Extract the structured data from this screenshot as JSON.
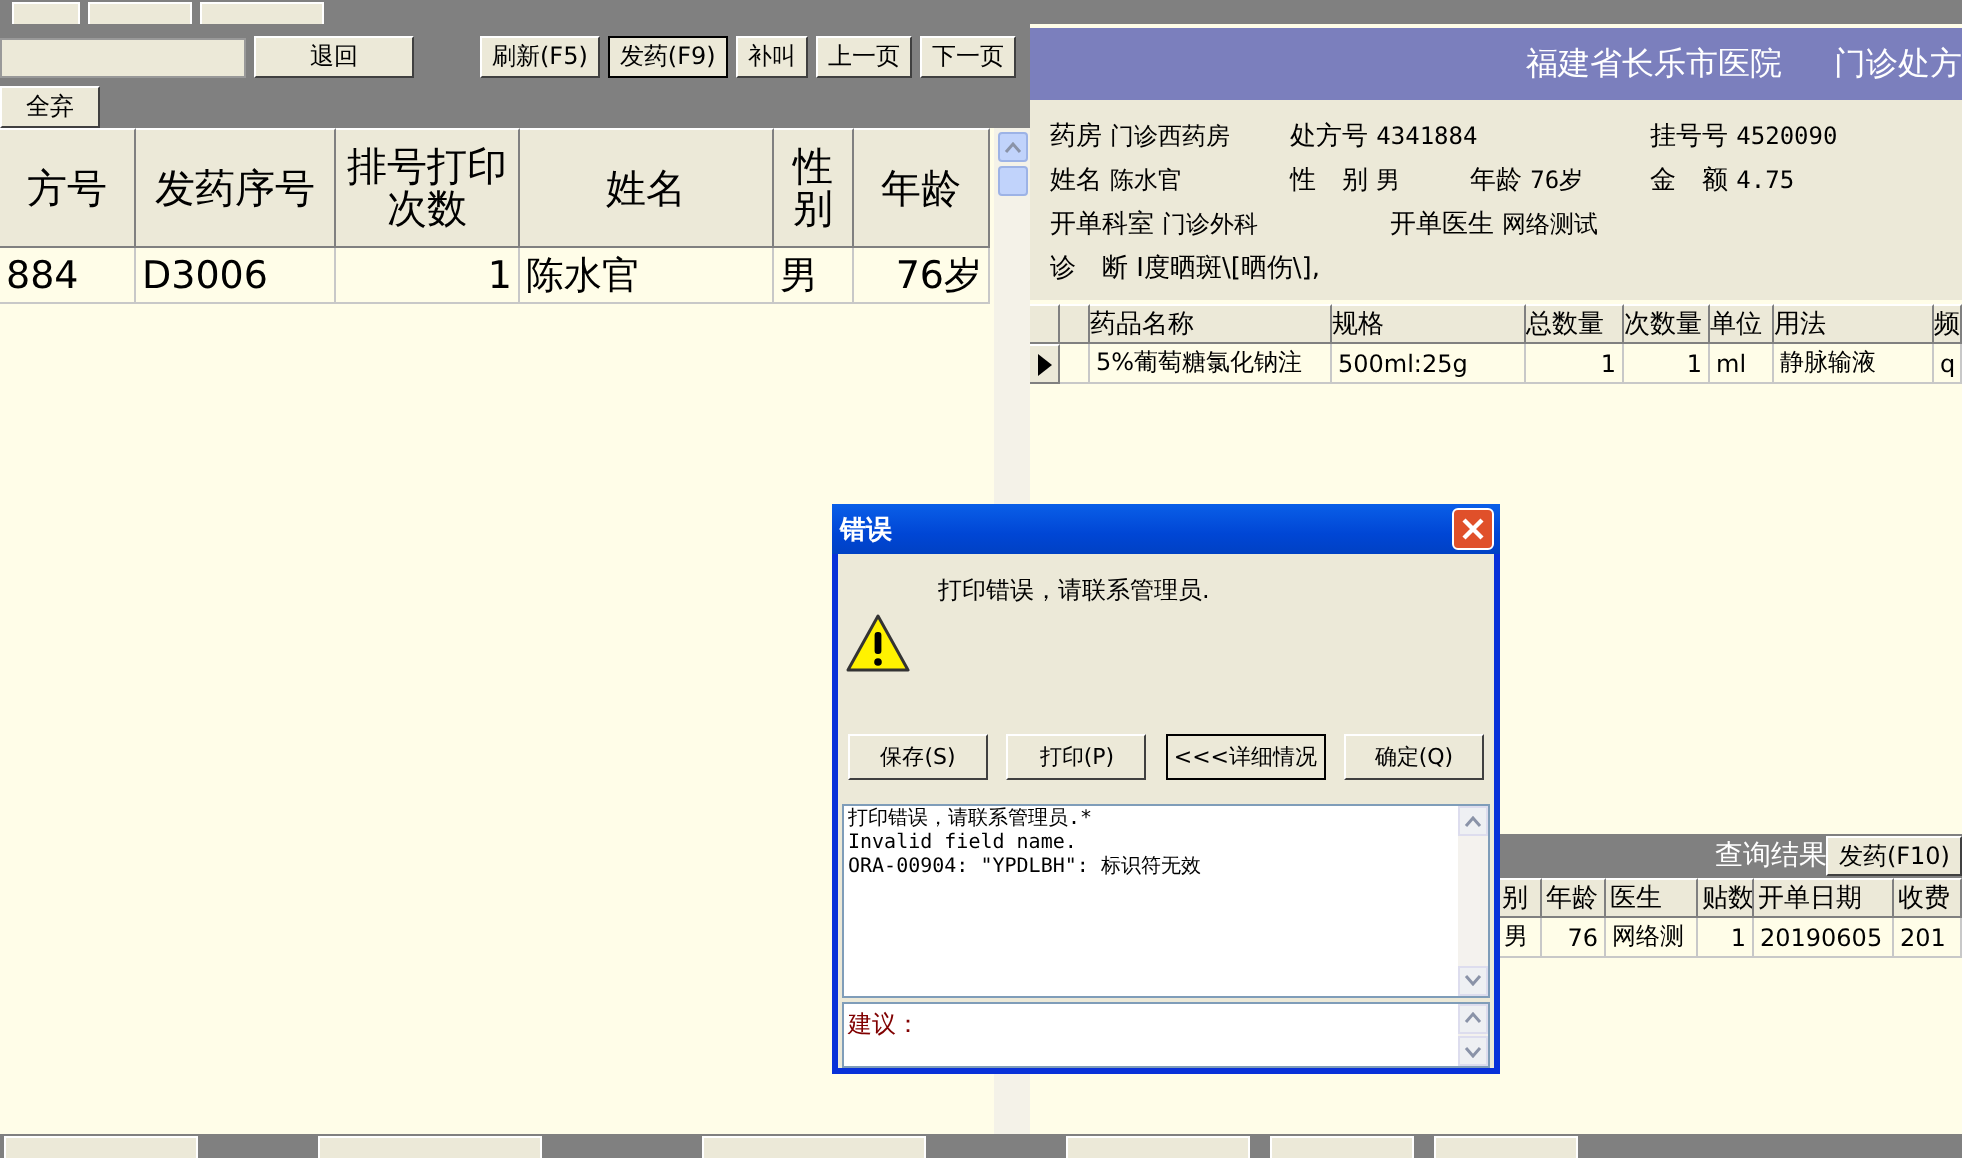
{
  "left_toolbar": {
    "return_button": "退回",
    "clear_button": "全弃",
    "nav_buttons": [
      {
        "label": "刷新(F5)",
        "focused": false
      },
      {
        "label": "发药(F9)",
        "focused": true
      },
      {
        "label": "补叫",
        "focused": false
      },
      {
        "label": "上一页",
        "focused": false
      },
      {
        "label": "下一页",
        "focused": false
      }
    ]
  },
  "queue_table": {
    "columns": [
      "方号",
      "发药序号",
      "排号打印次数",
      "姓名",
      "性别",
      "年龄"
    ],
    "rows": [
      [
        "884",
        "D3006",
        "1",
        "陈水官",
        "男",
        "76岁"
      ]
    ]
  },
  "prescription": {
    "hospital": "福建省长乐市医院",
    "title": "门诊处方",
    "info_rows": [
      [
        {
          "label": "药房",
          "value": "门诊西药房"
        },
        {
          "label": "处方号",
          "value": "4341884"
        },
        {
          "label": "挂号号",
          "value": "4520090"
        }
      ],
      [
        {
          "label": "姓名",
          "value": "陈水官"
        },
        {
          "label": "性　别",
          "value": "男"
        },
        {
          "label": "年龄",
          "value": "76岁"
        },
        {
          "label": "金　额",
          "value": "4.75"
        }
      ],
      [
        {
          "label": "开单科室",
          "value": "门诊外科"
        },
        {
          "label": "开单医生",
          "value": "网络测试"
        }
      ],
      [
        {
          "label": "诊　断",
          "value": "Ⅰ度晒斑\\[晒伤\\],"
        }
      ]
    ],
    "drug_table": {
      "columns": [
        "药品名称",
        "规格",
        "总数量",
        "次数量",
        "单位",
        "用法",
        "频"
      ],
      "rows": [
        {
          "current": true,
          "cells": [
            "5%葡萄糖氯化钠注",
            "500ml:25g",
            "1",
            "1",
            "ml",
            "静脉输液",
            "q"
          ]
        }
      ]
    }
  },
  "query_results": {
    "title": "查询结果",
    "dispense_button": "发药(F10)",
    "columns": [
      "别",
      "年龄",
      "医生",
      "贴数",
      "开单日期",
      "收费"
    ],
    "rows": [
      [
        "男",
        "76",
        "网络测",
        "1",
        "20190605",
        "201"
      ]
    ]
  },
  "dialog": {
    "title": "错误",
    "message": "打印错误，请联系管理员.",
    "buttons": [
      {
        "label": "保存(S)",
        "focused": false
      },
      {
        "label": "打印(P)",
        "focused": false
      },
      {
        "label": "<<<详细情况",
        "focused": true
      },
      {
        "label": "确定(Q)",
        "focused": false
      }
    ],
    "details": [
      "打印错误，请联系管理员.*",
      "Invalid field name.",
      "ORA-00904: \"YPDLBH\": 标识符无效"
    ],
    "suggestion_label": "建议："
  }
}
